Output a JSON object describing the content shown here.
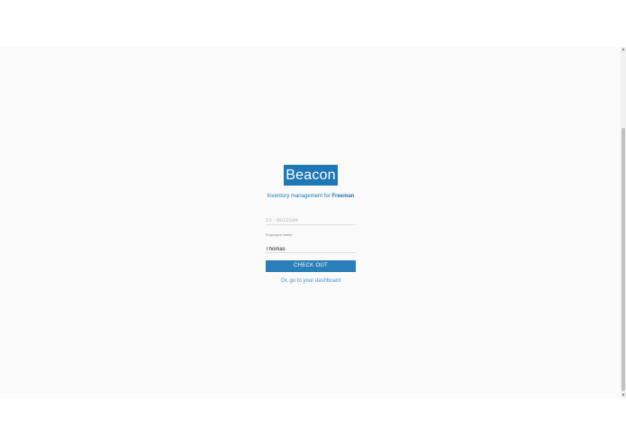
{
  "brand": {
    "logo_text": "Beacon",
    "accent_color": "#1f77b4"
  },
  "tagline": {
    "prefix": "Inventory management for ",
    "org": "Freeman"
  },
  "form": {
    "item_field": {
      "placeholder": "15 - Buzzsaw",
      "value": ""
    },
    "employee_field": {
      "label": "Employee Name",
      "value": "Thomas"
    },
    "submit_label": "CHECK OUT",
    "dashboard_link": "Or, go to your dashboard"
  },
  "scrollbar": {
    "up_arrow": "▲",
    "down_arrow": "▼"
  }
}
